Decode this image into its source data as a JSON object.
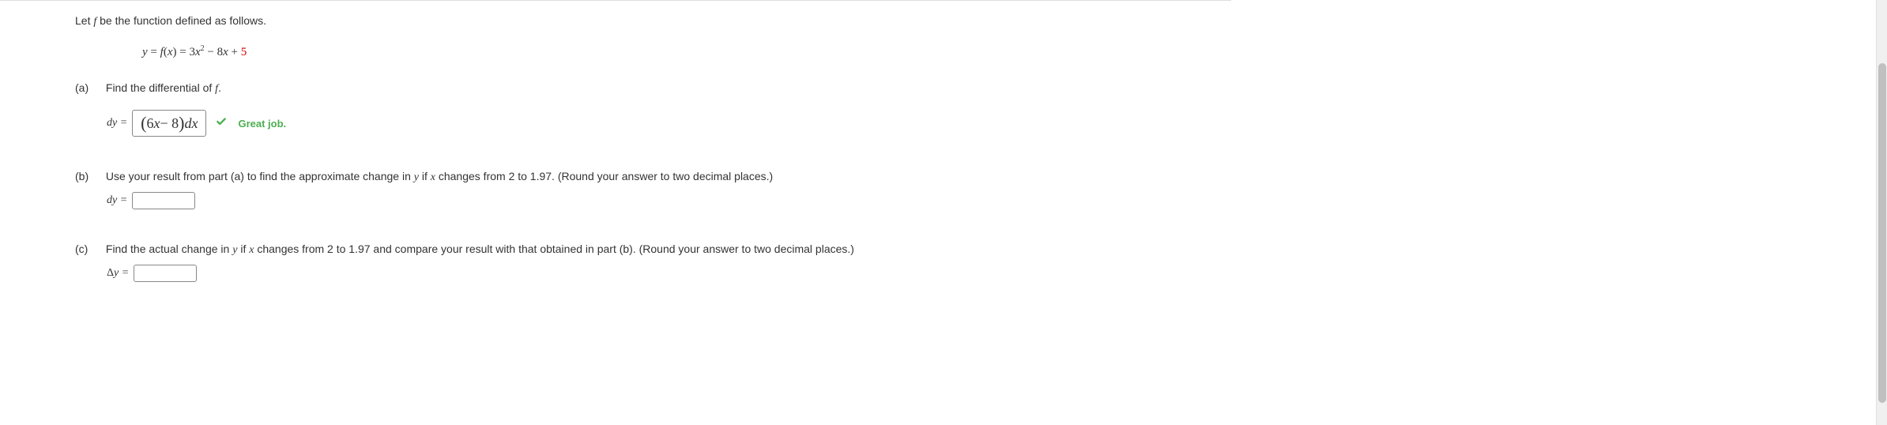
{
  "intro": "Let f be the function defined as follows.",
  "formula": {
    "lhs": "y = f(x) = ",
    "coef1": "3",
    "var1": "x",
    "exp1": "2",
    "op1": " − 8",
    "var2": "x",
    "op2": " + ",
    "const": "5"
  },
  "parts": {
    "a": {
      "label": "(a)",
      "text": "Find the differential of f.",
      "answer_prefix": "dy =",
      "answer_value": "(6x − 8)dx",
      "feedback": "Great job."
    },
    "b": {
      "label": "(b)",
      "text": "Use your result from part (a) to find the approximate change in y if x changes from 2 to 1.97. (Round your answer to two decimal places.)",
      "answer_prefix": "dy ="
    },
    "c": {
      "label": "(c)",
      "text": "Find the actual change in y if x changes from 2 to 1.97 and compare your result with that obtained in part (b). (Round your answer to two decimal places.)",
      "answer_prefix": "Δy ="
    }
  }
}
